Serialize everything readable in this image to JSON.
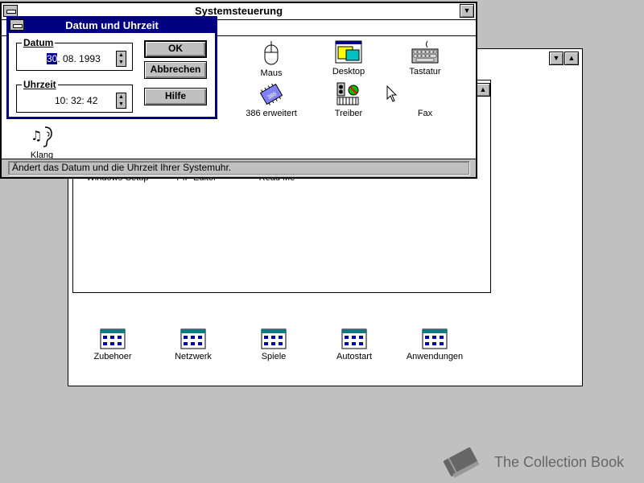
{
  "program_manager": {
    "group_icons": [
      {
        "label": "Zubehoer"
      },
      {
        "label": "Netzwerk"
      },
      {
        "label": "Spiele"
      },
      {
        "label": "Autostart"
      },
      {
        "label": "Anwendungen"
      }
    ]
  },
  "main_group": {
    "icons": [
      {
        "label": "Windows-Setup"
      },
      {
        "label": "PIF-Editor"
      },
      {
        "label": "Read Me"
      }
    ]
  },
  "systemsteuerung": {
    "title": "Systemsteuerung",
    "icons": [
      {
        "label": "Maus",
        "icon": "mouse-icon"
      },
      {
        "label": "Desktop",
        "icon": "desktop-icon"
      },
      {
        "label": "Tastatur",
        "icon": "keyboard-icon"
      },
      {
        "label": "386 erweitert",
        "icon": "chip-icon"
      },
      {
        "label": "Treiber",
        "icon": "drivers-icon"
      },
      {
        "label": "Fax",
        "icon": "fax-icon"
      },
      {
        "label": "Klang",
        "icon": "sound-icon"
      }
    ],
    "status_text": "Ändert das Datum und die Uhrzeit Ihrer Systemuhr."
  },
  "dialog": {
    "title": "Datum und Uhrzeit",
    "date_group_label": "Datum",
    "date_day": "30",
    "date_rest": ". 08. 1993",
    "time_group_label": "Uhrzeit",
    "time_value": "10: 32: 42",
    "ok_label": "OK",
    "cancel_label": "Abbrechen",
    "help_label": "Hilfe"
  },
  "watermark": {
    "text": "The Collection Book"
  },
  "colors": {
    "desktop": "#c0c0c0",
    "dialog_frame": "#000080",
    "selection": "#000080"
  }
}
